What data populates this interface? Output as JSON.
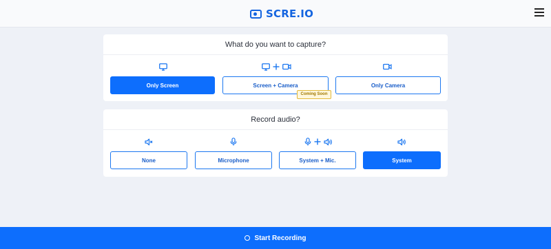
{
  "header": {
    "brand": "SCRE.IO",
    "logo_icon": "screen-record-logo-icon",
    "menu_icon": "hamburger-menu-icon"
  },
  "capture": {
    "question": "What do you want to capture?",
    "options": [
      {
        "label": "Only Screen",
        "icon": "monitor-icon",
        "selected": true
      },
      {
        "label": "Screen + Camera",
        "icon": "monitor-plus-camera-icon",
        "selected": false,
        "badge": "Coming Soon"
      },
      {
        "label": "Only Camera",
        "icon": "video-camera-icon",
        "selected": false
      }
    ]
  },
  "audio": {
    "question": "Record audio?",
    "options": [
      {
        "label": "None",
        "icon": "speaker-muted-icon",
        "selected": false
      },
      {
        "label": "Microphone",
        "icon": "microphone-icon",
        "selected": false
      },
      {
        "label": "System + Mic.",
        "icon": "microphone-plus-speaker-icon",
        "selected": false
      },
      {
        "label": "System",
        "icon": "speaker-icon",
        "selected": true
      }
    ]
  },
  "footer": {
    "start_label": "Start Recording",
    "start_icon": "record-circle-icon"
  },
  "colors": {
    "accent": "#0d6efd",
    "brand": "#1565e0",
    "badge_bg": "#fff7dc",
    "page_bg": "#eef1f7"
  }
}
